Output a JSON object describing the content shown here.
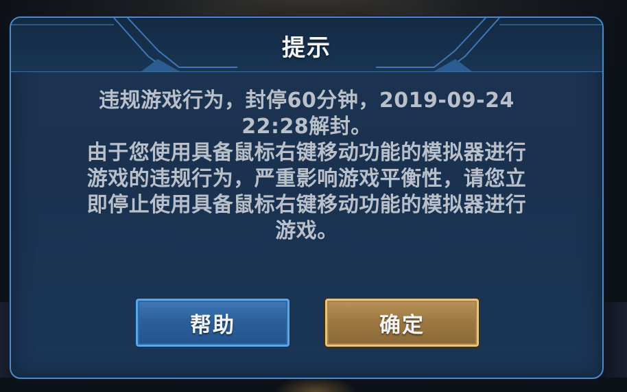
{
  "dialog": {
    "title": "提示",
    "message_lines": [
      "违规游戏行为，封停60分钟，2019-09-24",
      "22:28解封。",
      "由于您使用具备鼠标右键移动功能的模拟器进行",
      "游戏的违规行为，严重影响游戏平衡性，请您立",
      "即停止使用具备鼠标右键移动功能的模拟器进行",
      "游戏。"
    ],
    "buttons": {
      "help_label": "帮助",
      "ok_label": "确定"
    }
  },
  "colors": {
    "dialog_border": "#4e8ac9",
    "dialog_bg": "#1a3250",
    "help_button": "#2b5f9a",
    "ok_button": "#9b7641",
    "message_text": "#b9c0c9",
    "title_text": "#f4f6fa"
  }
}
